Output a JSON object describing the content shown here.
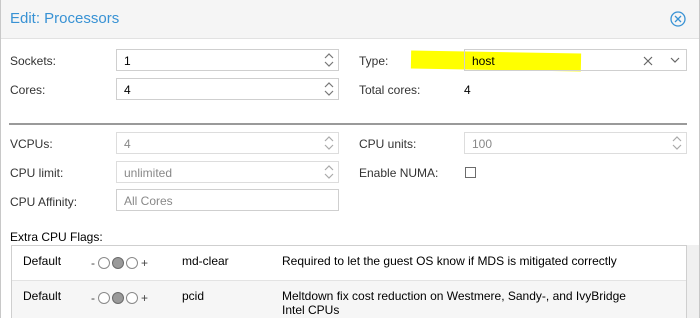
{
  "dialog": {
    "title": "Edit: Processors"
  },
  "fields": {
    "sockets": {
      "label": "Sockets:",
      "value": "1"
    },
    "cores": {
      "label": "Cores:",
      "value": "4"
    },
    "type": {
      "label": "Type:",
      "value": "host"
    },
    "total_cores": {
      "label": "Total cores:",
      "value": "4"
    },
    "vcpus": {
      "label": "VCPUs:",
      "value": "4"
    },
    "cpu_units": {
      "label": "CPU units:",
      "value": "100"
    },
    "cpu_limit": {
      "label": "CPU limit:",
      "value": "unlimited"
    },
    "enable_numa": {
      "label": "Enable NUMA:",
      "checked": false
    },
    "cpu_affinity": {
      "label": "CPU Affinity:",
      "placeholder": "All Cores"
    }
  },
  "flags": {
    "label": "Extra CPU Flags:",
    "rows": [
      {
        "state": "Default",
        "minus": "-",
        "plus": "+",
        "flag": "md-clear",
        "description": "Required to let the guest OS know if MDS is mitigated correctly"
      },
      {
        "state": "Default",
        "minus": "-",
        "plus": "+",
        "flag": "pcid",
        "description_line1": "Meltdown fix cost reduction on Westmere, Sandy-, and IvyBridge",
        "description_line2": "Intel CPUs"
      }
    ]
  },
  "colors": {
    "title": "#3892d4",
    "highlight": "#ffff00"
  }
}
